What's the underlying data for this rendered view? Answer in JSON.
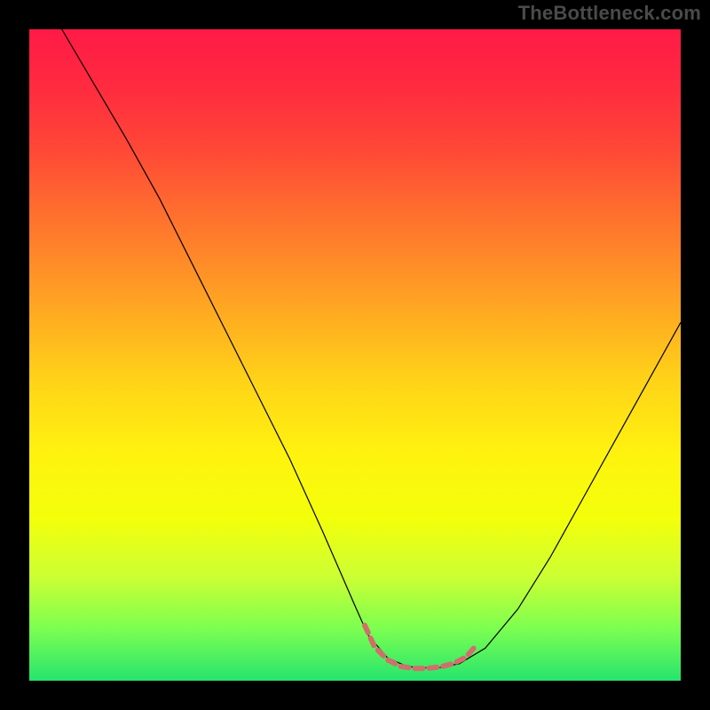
{
  "watermark": "TheBottleneck.com",
  "chart_data": {
    "type": "line",
    "title": "",
    "xlabel": "",
    "ylabel": "",
    "xlim": [
      0,
      100
    ],
    "ylim": [
      0,
      100
    ],
    "grid": false,
    "legend": false,
    "series": [
      {
        "name": "curve",
        "color": "#000000",
        "width": 1.2,
        "x": [
          5,
          10,
          15,
          20,
          25,
          30,
          35,
          40,
          45,
          50,
          52,
          55,
          58,
          60,
          63,
          66,
          70,
          75,
          80,
          85,
          90,
          95,
          100
        ],
        "y": [
          100,
          91.5,
          83,
          74,
          64,
          54,
          44,
          34,
          23,
          11.5,
          7,
          3.5,
          2.2,
          2,
          2,
          2.6,
          5,
          11,
          19,
          28,
          37,
          46,
          55
        ]
      },
      {
        "name": "bottom-segment",
        "color": "#d06f6d",
        "width": 6,
        "x": [
          51.5,
          53,
          55,
          57,
          59,
          61,
          63,
          65,
          67,
          68.5
        ],
        "y": [
          8.5,
          5.2,
          3.2,
          2.2,
          1.9,
          1.9,
          2.1,
          2.6,
          3.6,
          5.3
        ]
      }
    ],
    "gradient_stops": [
      {
        "pos": 0,
        "color": "#ff1a46"
      },
      {
        "pos": 27,
        "color": "#ff6a2f"
      },
      {
        "pos": 54,
        "color": "#ffd318"
      },
      {
        "pos": 75,
        "color": "#f4ff0a"
      },
      {
        "pos": 92,
        "color": "#7cff50"
      },
      {
        "pos": 100,
        "color": "#26e46e"
      }
    ]
  }
}
